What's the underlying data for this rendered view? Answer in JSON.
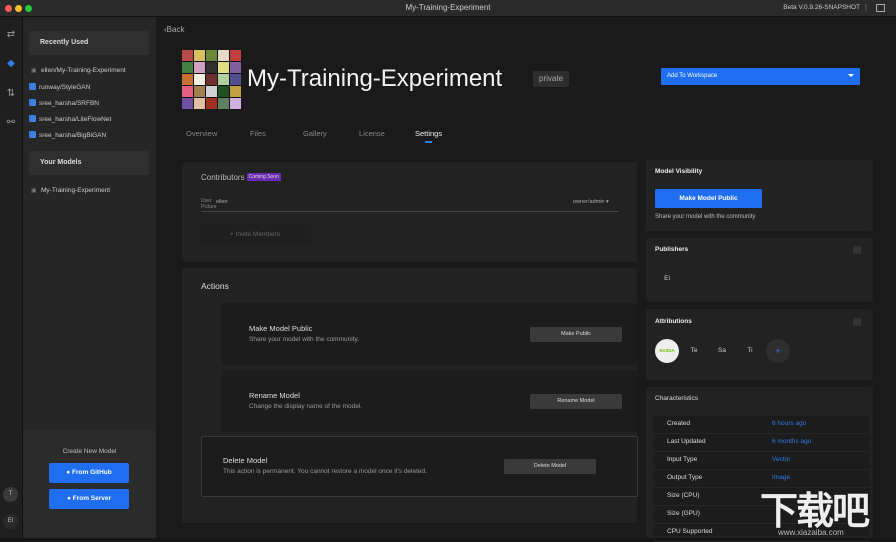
{
  "window": {
    "title": "My-Training-Experiment",
    "version": "Beta V.0.9.26-SNAPSHOT",
    "separator": "|"
  },
  "rail": {
    "avatar_top": "T",
    "avatar_bottom": "El"
  },
  "sidebar": {
    "recent_header": "Recently Used",
    "recent_items": [
      {
        "label": "ellen/My-Training-Experiment",
        "icon": "lock-icon"
      },
      {
        "label": "runway/StyleGAN",
        "icon": "checkbox-icon"
      },
      {
        "label": "sree_harsha/SRFBN",
        "icon": "checkbox-icon"
      },
      {
        "label": "sree_harsha/LiteFlowNet",
        "icon": "checkbox-icon"
      },
      {
        "label": "sree_harsha/BigBiGAN",
        "icon": "checkbox-icon"
      }
    ],
    "models_header": "Your Models",
    "model_items": [
      {
        "label": "My-Training-Experiment",
        "icon": "lock-icon"
      }
    ],
    "create_label": "Create New Model",
    "github_button": "From GitHub",
    "server_button": "From Server"
  },
  "header": {
    "back": "Back",
    "model_name": "My-Training-Experiment",
    "visibility_badge": "private",
    "workspace_select": "Add To Workspace",
    "thumb_colors": [
      "#b84a4a",
      "#d8c060",
      "#6a8a3a",
      "#e8d8c8",
      "#c04040",
      "#408040",
      "#d0a0c0",
      "#303030",
      "#e0e080",
      "#8060a0",
      "#c87030",
      "#f0f0e0",
      "#703030",
      "#b0d0a0",
      "#505090",
      "#e06080",
      "#a08050",
      "#d0d0d0",
      "#205020",
      "#c0a040",
      "#7050a0",
      "#e0c0a0",
      "#a03020",
      "#608060",
      "#d0b0e0"
    ]
  },
  "tabs": [
    "Overview",
    "Files",
    "Gallery",
    "License",
    "Settings"
  ],
  "contributors": {
    "title": "Contributors",
    "badge": "Coming Soon",
    "user_name": "ellen",
    "user_picture_alt": "User Picture",
    "role": "owner/admin",
    "invite": "+ Invite Members"
  },
  "actions": {
    "title": "Actions",
    "items": [
      {
        "title": "Make Model Public",
        "desc": "Share your model with the community.",
        "button": "Make Public"
      },
      {
        "title": "Rename Model",
        "desc": "Change the display name of the model.",
        "button": "Rename Model"
      },
      {
        "title": "Delete Model",
        "desc": "This action is permanent. You cannot restore a model once it's deleted.",
        "button": "Delete Model"
      }
    ]
  },
  "visibility": {
    "title": "Model Visibility",
    "button": "Make Model Public",
    "desc": "Share your model with the community"
  },
  "publishers": {
    "title": "Publishers",
    "items": [
      "El"
    ]
  },
  "attributions": {
    "title": "Attributions",
    "logo": "NVIDIA",
    "items": [
      "Te",
      "Sa",
      "Ti"
    ],
    "add": "+"
  },
  "characteristics": {
    "title": "Characteristics",
    "rows": [
      {
        "k": "Created",
        "v": "6 hours ago"
      },
      {
        "k": "Last Updated",
        "v": "6 months ago"
      },
      {
        "k": "Input Type",
        "v": "Vector"
      },
      {
        "k": "Output Type",
        "v": "Image"
      },
      {
        "k": "Size (CPU)",
        "v": ""
      },
      {
        "k": "Size (GPU)",
        "v": ""
      },
      {
        "k": "CPU Supported",
        "v": ""
      }
    ]
  },
  "watermark": {
    "text": "下载吧",
    "url": "www.xiazaiba.com"
  }
}
